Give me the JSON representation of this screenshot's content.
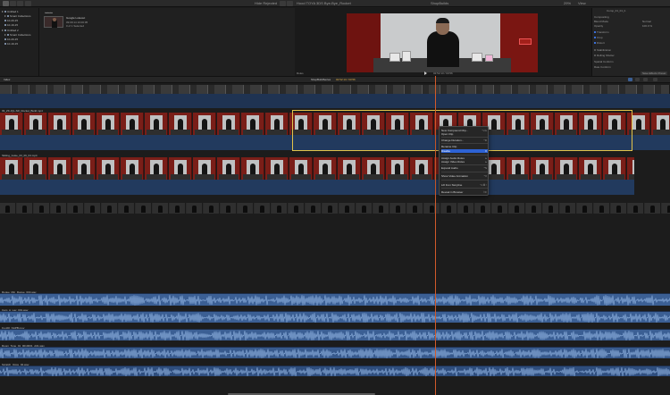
{
  "toolbar": {
    "filter_label": "Hide Rejected",
    "title": "Hood TOYA 3DS Bye-Bye_Rocket",
    "viewer_title": "ShopBuilds",
    "zoom": "29%",
    "view_label": "View"
  },
  "library": {
    "items": [
      {
        "label": "Untitled 1"
      },
      {
        "label": "Smart Collections"
      },
      {
        "label": "10-20-15"
      },
      {
        "label": "10-19-15"
      },
      {
        "label": "Untitled 2"
      },
      {
        "label": "Smart Collections"
      },
      {
        "label": "10-20-15"
      },
      {
        "label": "10-19-15"
      }
    ]
  },
  "browser": {
    "clip_title": "Google Lokeout",
    "clip_meta1": "09:09:14 10:00:05",
    "clip_meta2": "0 of 1 Selected"
  },
  "viewer": {
    "timecode_label": "Roles"
  },
  "inspector": {
    "header": "Comp_01_01_b",
    "section": "Compositing",
    "rows": [
      {
        "label": "Blend Mode",
        "value": "Normal"
      },
      {
        "label": "Opacity",
        "value": "100.0 %"
      },
      {
        "label": "Transform",
        "value": ""
      },
      {
        "label": "Crop",
        "value": ""
      },
      {
        "label": "Distort",
        "value": ""
      },
      {
        "label": "Stabilization",
        "value": ""
      },
      {
        "label": "Rolling Shutter",
        "value": ""
      },
      {
        "label": "Spatial Conform",
        "value": ""
      },
      {
        "label": "Rate Conform",
        "value": ""
      }
    ],
    "footer_button": "Save Effects Preset"
  },
  "timeline_bar": {
    "index_label": "Index",
    "project": "ShopBuildSeries",
    "timecode": "02:52:13 / 03:56"
  },
  "tracks": {
    "v1_label": "09_ZK-IQL-SR_Rocket_Build.mp4",
    "v2_label": "Sliding_Goke_03_09_04.mp4",
    "a1_label": "Rogue_Mic_Rogue_003.wav",
    "a2_label": "Cam_A_Lav_001.wav",
    "a3_label": "Fs.ADl_NAPB.mov",
    "a4_label": "Room_Tone_01_0010001_A01.wav",
    "a5_label": "Scratch_Voice_02.wav"
  },
  "context_menu": {
    "items": [
      {
        "label": "New Compound Clip...",
        "shortcut": "⌥G"
      },
      {
        "label": "Open Clip",
        "shortcut": ""
      },
      {
        "label": "Change Duration...",
        "shortcut": "^D"
      },
      {
        "label": "Rename Clip",
        "shortcut": ""
      },
      {
        "label": "Disable",
        "shortcut": "V",
        "highlight": true
      },
      {
        "label": "Assign Audio Roles",
        "shortcut": "▸"
      },
      {
        "label": "Assign Video Roles",
        "shortcut": "▸"
      },
      {
        "label": "Expand Audio",
        "shortcut": "^S"
      },
      {
        "label": "Show Video Animation",
        "shortcut": "^V"
      },
      {
        "label": "Lift from Storyline",
        "shortcut": "⌥⌘↑"
      },
      {
        "label": "Reveal in Browser",
        "shortcut": "⇧F"
      }
    ]
  }
}
